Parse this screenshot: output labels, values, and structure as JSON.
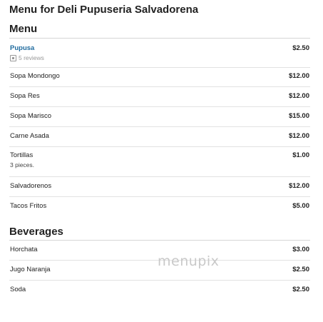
{
  "page_title": "Menu for Deli Pupuseria Salvadorena",
  "sections": [
    {
      "title": "Menu",
      "items": [
        {
          "name": "Pupusa",
          "price": "$2.50",
          "reviews": "5 reviews"
        },
        {
          "name": "Sopa Mondongo",
          "price": "$12.00"
        },
        {
          "name": "Sopa Res",
          "price": "$12.00"
        },
        {
          "name": "Sopa Marisco",
          "price": "$15.00"
        },
        {
          "name": "Carne Asada",
          "price": "$12.00"
        },
        {
          "name": "Tortillas",
          "price": "$1.00",
          "desc": "3 pieces."
        },
        {
          "name": "Salvadorenos",
          "price": "$12.00"
        },
        {
          "name": "Tacos Fritos",
          "price": "$5.00"
        }
      ]
    },
    {
      "title": "Beverages",
      "items": [
        {
          "name": "Horchata",
          "price": "$3.00"
        },
        {
          "name": "Jugo Naranja",
          "price": "$2.50"
        },
        {
          "name": "Soda",
          "price": "$2.50"
        }
      ]
    }
  ],
  "watermark": "menupix"
}
